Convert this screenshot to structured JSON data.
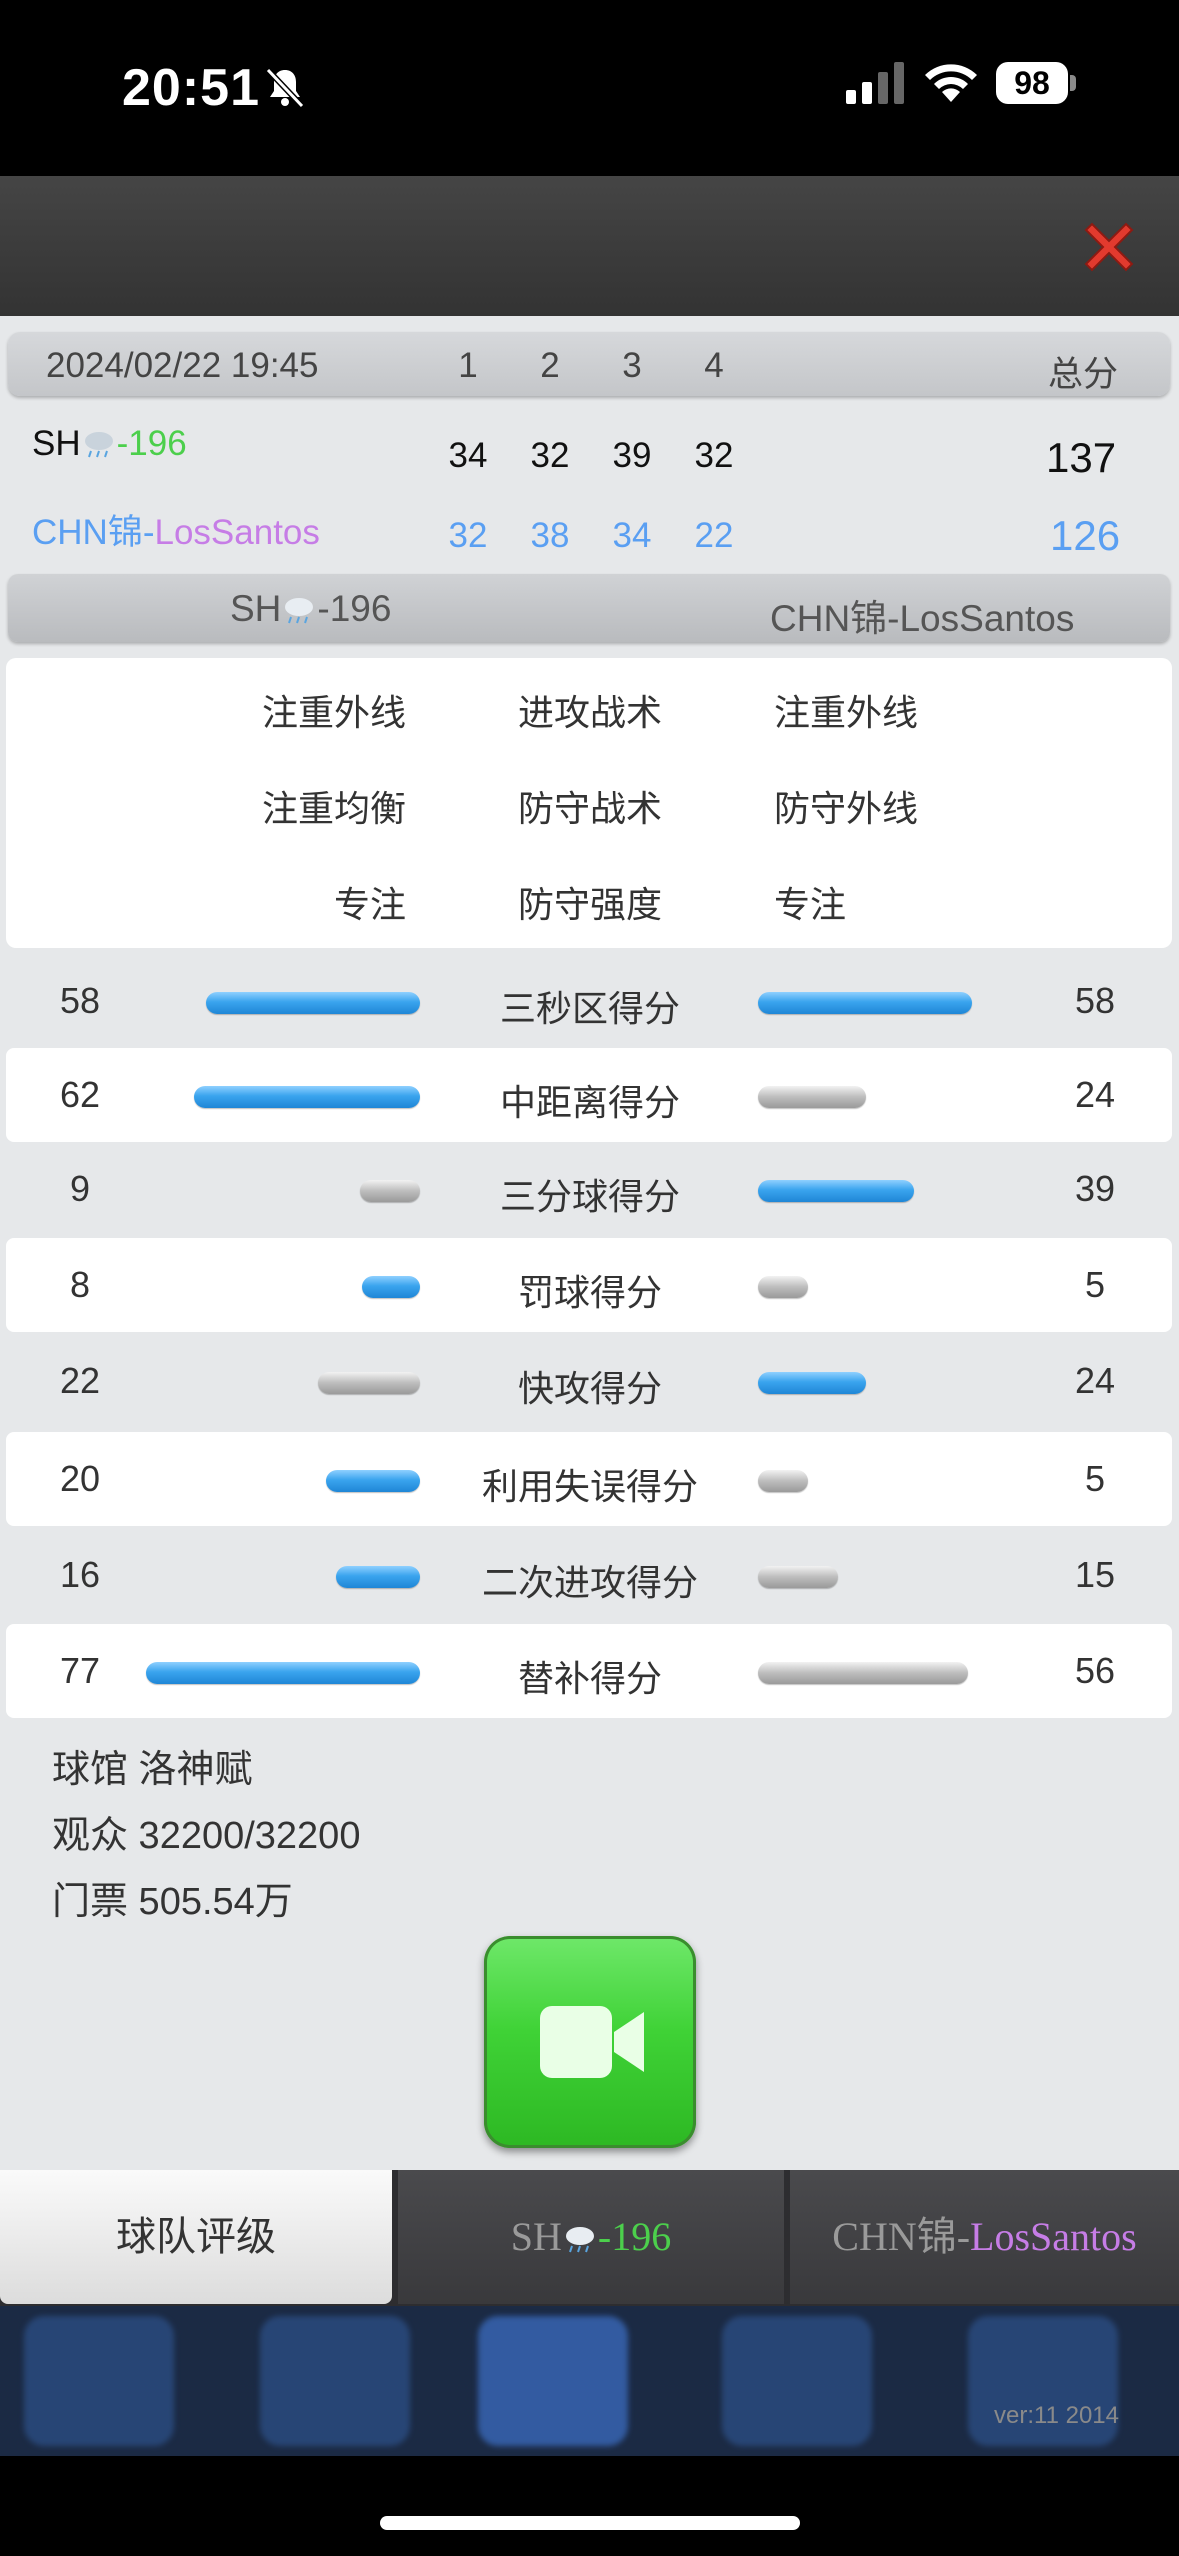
{
  "status_bar": {
    "time": "20:51",
    "battery": "98"
  },
  "score_table": {
    "date": "2024/02/22 19:45",
    "quarters": [
      "1",
      "2",
      "3",
      "4"
    ],
    "total_label": "总分",
    "home": {
      "name_prefix": "SH",
      "name_suffix": "-196",
      "scores": [
        "34",
        "32",
        "39",
        "32"
      ],
      "total": "137"
    },
    "away": {
      "name_prefix": "CHN锦-",
      "name_suffix": "LosSantos",
      "scores": [
        "32",
        "38",
        "34",
        "22"
      ],
      "total": "126"
    }
  },
  "team_bar": {
    "home_prefix": "SH",
    "home_suffix": "-196",
    "away_prefix": "CHN锦-",
    "away_suffix": "LosSantos"
  },
  "tactics": {
    "home": [
      "注重外线",
      "注重均衡",
      "专注"
    ],
    "center": [
      "进攻战术",
      "防守战术",
      "防守强度"
    ],
    "away": [
      "注重外线",
      "防守外线",
      "专注"
    ]
  },
  "stats": [
    {
      "label": "三秒区得分",
      "home": "58",
      "away": "58",
      "home_bar": "blue",
      "away_bar": "blue"
    },
    {
      "label": "中距离得分",
      "home": "62",
      "away": "24",
      "home_bar": "blue",
      "away_bar": "gray"
    },
    {
      "label": "三分球得分",
      "home": "9",
      "away": "39",
      "home_bar": "gray",
      "away_bar": "blue"
    },
    {
      "label": "罚球得分",
      "home": "8",
      "away": "5",
      "home_bar": "blue",
      "away_bar": "gray"
    },
    {
      "label": "快攻得分",
      "home": "22",
      "away": "24",
      "home_bar": "gray",
      "away_bar": "blue"
    },
    {
      "label": "利用失误得分",
      "home": "20",
      "away": "5",
      "home_bar": "blue",
      "away_bar": "gray"
    },
    {
      "label": "二次进攻得分",
      "home": "16",
      "away": "15",
      "home_bar": "blue",
      "away_bar": "gray"
    },
    {
      "label": "替补得分",
      "home": "77",
      "away": "56",
      "home_bar": "blue",
      "away_bar": "gray"
    }
  ],
  "venue_info": {
    "arena": "球馆 洛神赋",
    "attendance": "观众 32200/32200",
    "tickets": "门票 505.54万"
  },
  "tabs": {
    "team_rating": "球队评级",
    "home_prefix": "SH",
    "home_suffix": "-196",
    "away_prefix": "CHN锦-",
    "away_suffix": "LosSantos"
  },
  "footer": {
    "version": "ver:11  2014"
  },
  "colors": {
    "green_team": "#4ccf4c",
    "purple_team": "#c67de6",
    "blue_score": "#5a9ff2",
    "bar_blue": "#2f96e3",
    "bar_gray": "#b0b0b0"
  }
}
